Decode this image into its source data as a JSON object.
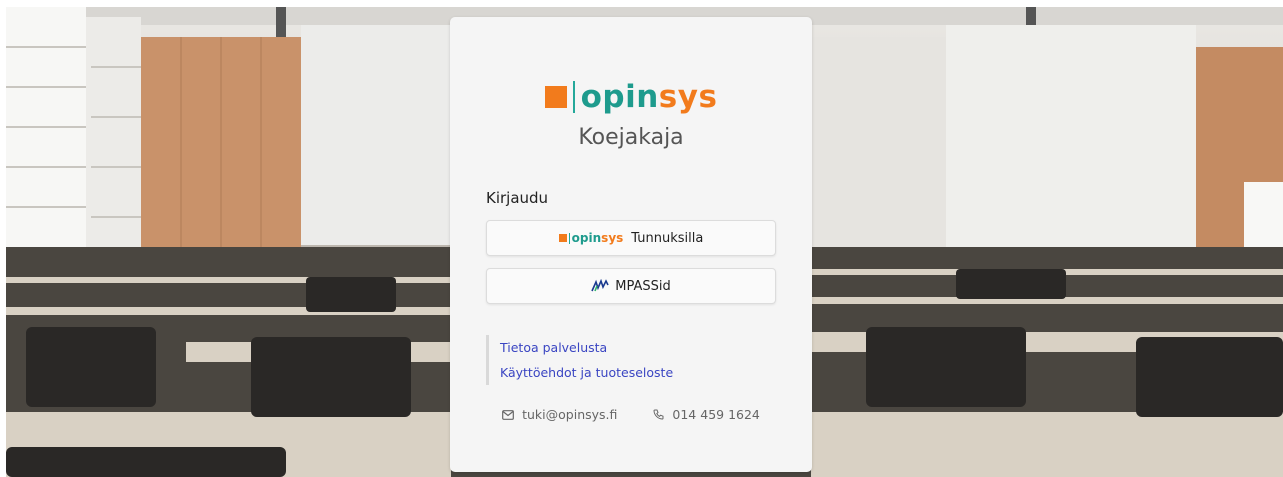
{
  "brand": {
    "logo_text_start": "opin",
    "logo_text_end": "sys",
    "color_orange": "#f27b1c",
    "color_teal": "#1e9b8d"
  },
  "card": {
    "site_title": "Koejakaja",
    "login_heading": "Kirjaudu",
    "buttons": {
      "opinsys_label": "Tunnuksilla",
      "mpass_label": "MPASSid"
    },
    "links": {
      "about": "Tietoa palvelusta",
      "terms": "Käyttöehdot ja tuoteseloste"
    },
    "contact": {
      "email": "tuki@opinsys.fi",
      "phone": "014 459 1624"
    }
  },
  "icons": {
    "email": "envelope-icon",
    "phone": "phone-icon",
    "mpass": "mpass-logo-icon"
  }
}
